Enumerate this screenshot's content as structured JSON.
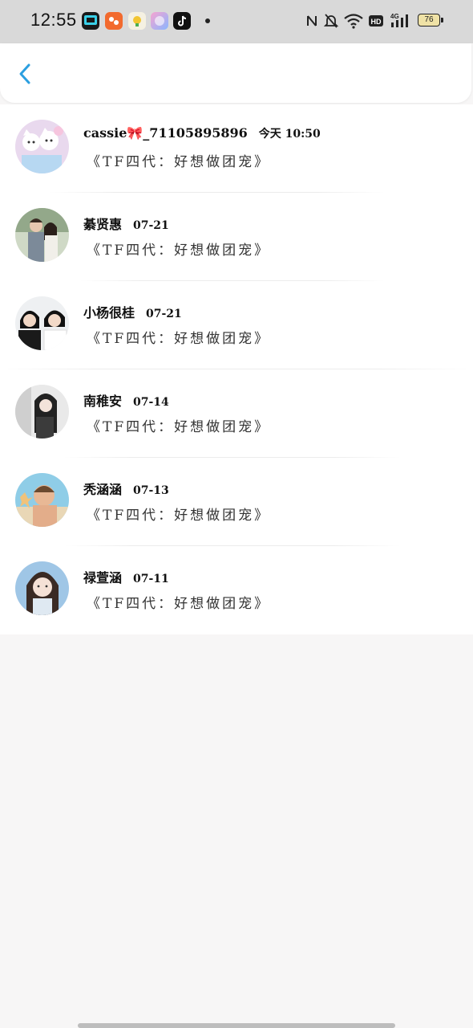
{
  "status_bar": {
    "time": "12:55",
    "battery": "76",
    "app_icons": [
      "app-icon-1",
      "app-icon-2",
      "app-icon-3",
      "app-icon-4",
      "tiktok-icon"
    ],
    "system_icons": [
      "nfc-icon",
      "mute-icon",
      "wifi-icon",
      "hd-icon",
      "signal-4g-icon"
    ]
  },
  "header": {
    "back_icon": "chevron-left-icon",
    "accent": "#2b9fe0"
  },
  "items": [
    {
      "name": "cassie🎀_71105895896",
      "time": "今天 10:50",
      "message": "《TF四代：好想做团宠》"
    },
    {
      "name": "綦贤惠",
      "time": "07-21",
      "message": "《TF四代：好想做团宠》"
    },
    {
      "name": "小杨很桂",
      "time": "07-21",
      "message": "《TF四代：好想做团宠》"
    },
    {
      "name": "南稚安",
      "time": "07-14",
      "message": "《TF四代：好想做团宠》"
    },
    {
      "name": "秃涵涵",
      "time": "07-13",
      "message": "《TF四代：好想做团宠》"
    },
    {
      "name": "禄萱涵",
      "time": "07-11",
      "message": "《TF四代：好想做团宠》"
    }
  ]
}
